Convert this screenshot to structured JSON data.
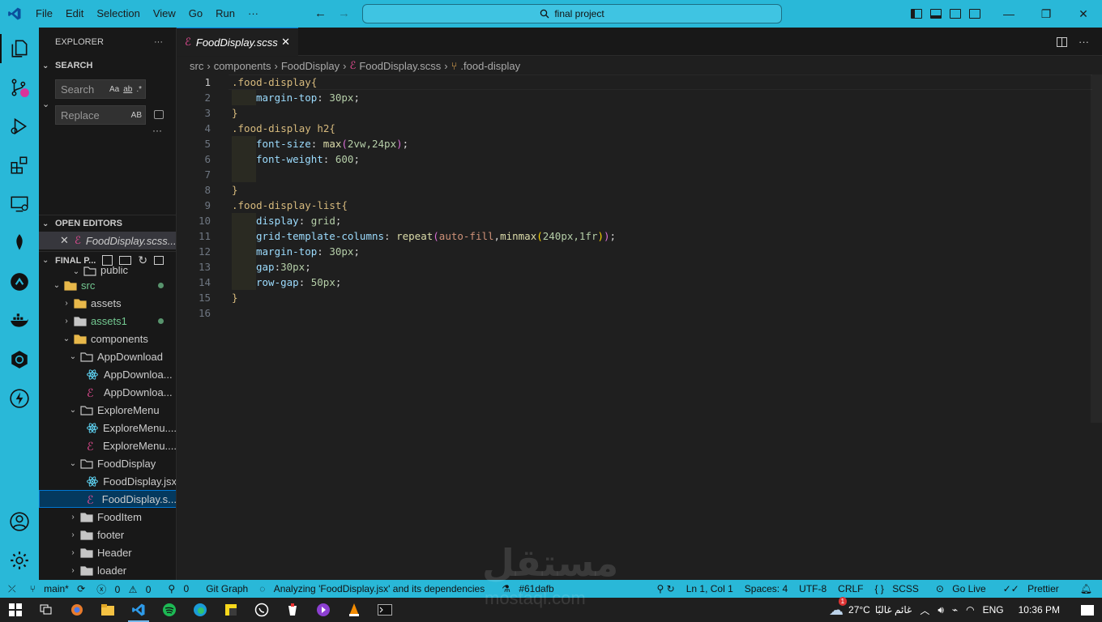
{
  "titlebar": {
    "menu": [
      "File",
      "Edit",
      "Selection",
      "View",
      "Go",
      "Run",
      "···"
    ],
    "search": "final project",
    "nav_back": "←",
    "nav_forward": "→",
    "minimize": "—",
    "restore": "❐",
    "close": "✕"
  },
  "sidebar": {
    "title": "EXPLORER",
    "more": "···",
    "search_section": "SEARCH",
    "search_placeholder": "Search",
    "search_opts": [
      "Aa",
      "ab",
      ".*"
    ],
    "replace_placeholder": "Replace",
    "replace_opt": "AB",
    "open_editors": "OPEN EDITORS",
    "open_file": "FoodDisplay.scss...",
    "project": "FINAL P...",
    "tree": [
      {
        "label": "public",
        "type": "folder-open"
      },
      {
        "label": "src",
        "type": "folder-open"
      },
      {
        "label": "assets",
        "type": "folder"
      },
      {
        "label": "assets1",
        "type": "folder"
      },
      {
        "label": "components",
        "type": "folder-open"
      },
      {
        "label": "AppDownload",
        "type": "folder-open"
      },
      {
        "label": "AppDownloa...",
        "type": "react"
      },
      {
        "label": "AppDownloa...",
        "type": "scss"
      },
      {
        "label": "ExploreMenu",
        "type": "folder-open"
      },
      {
        "label": "ExploreMenu....",
        "type": "react"
      },
      {
        "label": "ExploreMenu....",
        "type": "scss"
      },
      {
        "label": "FoodDisplay",
        "type": "folder-open"
      },
      {
        "label": "FoodDisplay.jsx",
        "type": "react"
      },
      {
        "label": "FoodDisplay.s...",
        "type": "scss"
      },
      {
        "label": "FoodItem",
        "type": "folder"
      },
      {
        "label": "footer",
        "type": "folder"
      },
      {
        "label": "Header",
        "type": "folder"
      },
      {
        "label": "loader",
        "type": "folder"
      }
    ]
  },
  "editor": {
    "tab_label": "FoodDisplay.scss",
    "tab_close": "✕",
    "breadcrumb": [
      "src",
      "components",
      "FoodDisplay",
      "FoodDisplay.scss",
      ".food-display"
    ],
    "line_numbers": [
      "1",
      "2",
      "3",
      "4",
      "5",
      "6",
      "7",
      "8",
      "9",
      "10",
      "11",
      "12",
      "13",
      "14",
      "15",
      "16"
    ],
    "code": {
      "l1": ".food-display{",
      "l2_prop": "margin-top",
      "l2_val": "30px",
      "l3": "}",
      "l4": ".food-display h2{",
      "l5_prop": "font-size",
      "l5_fn": "max",
      "l5_args": "2vw,24px",
      "l6_prop": "font-weight",
      "l6_val": "600",
      "l8": "}",
      "l9": ".food-display-list{",
      "l10_prop": "display",
      "l10_val": "grid",
      "l11_prop": "grid-template-columns",
      "l11_fn": "repeat",
      "l11_kw": "auto-fill",
      "l11_fn2": "minmax",
      "l11_args": "240px,1fr",
      "l12_prop": "margin-top",
      "l12_val": "30px",
      "l13_prop": "gap",
      "l13_val": "30px",
      "l14_prop": "row-gap",
      "l14_val": "50px",
      "l15": "}"
    }
  },
  "statusbar": {
    "branch": "main*",
    "errors": "0",
    "warnings": "0",
    "ports": "0",
    "git_graph": "Git Graph",
    "analyzing": "Analyzing 'FoodDisplay.jsx' and its dependencies",
    "commit": "#61dafb",
    "position": "Ln 1, Col 1",
    "spaces": "Spaces: 4",
    "encoding": "UTF-8",
    "eol": "CRLF",
    "language": "SCSS",
    "golive": "Go Live",
    "prettier": "Prettier"
  },
  "taskbar": {
    "weather": "27°C",
    "weather_desc": "غائم غالبًا",
    "lang": "ENG",
    "time": "10:36 PM",
    "notification_count": "1"
  },
  "watermark": {
    "arabic": "مستقل",
    "latin": "mostaql.com"
  },
  "colors": {
    "accent": "#29b8d8",
    "selection": "#04395e",
    "tab_border": "#0078d4"
  }
}
